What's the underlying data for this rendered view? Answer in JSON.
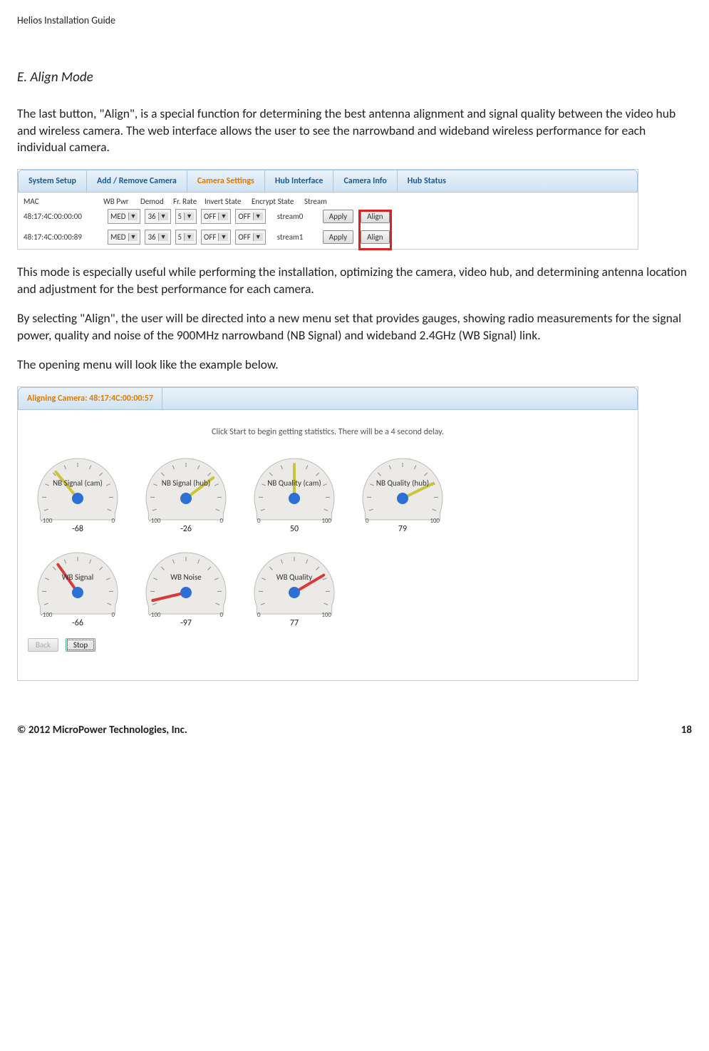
{
  "doc": {
    "header": "Helios Installation Guide",
    "section_title": "E. Align Mode",
    "para1": "The last button, \"Align\", is a special function for determining the best antenna alignment and signal quality between the video hub and  wireless camera.  The web interface allows the user to see the narrowband and wideband wireless performance for each individual camera.",
    "para2": "This mode is especially useful while performing the installation, optimizing the camera, video hub, and determining antenna location and adjustment for the best performance for each camera.",
    "para3": "By selecting \"Align\", the user will be directed into a new menu set that provides gauges, showing radio measurements for the signal power, quality and noise of the 900MHz narrowband (NB Signal) and wideband 2.4GHz (WB Signal) link.",
    "para4": "The opening menu will look like the example below.",
    "footer_left": "© 2012 MicroPower Technologies, Inc.",
    "footer_right": "18"
  },
  "shot1": {
    "tabs": [
      "System Setup",
      "Add / Remove Camera",
      "Camera Settings",
      "Hub Interface",
      "Camera Info",
      "Hub Status"
    ],
    "cols": {
      "mac": "MAC",
      "wbpwr": "WB Pwr",
      "demod": "Demod",
      "fr": "Fr. Rate",
      "invert": "Invert State",
      "encrypt": "Encrypt State",
      "stream": "Stream"
    },
    "rows": [
      {
        "mac": "48:17:4C:00:00:00",
        "wbpwr": "MED",
        "demod": "36",
        "fr": "5",
        "invert": "OFF",
        "encrypt": "OFF",
        "stream": "stream0"
      },
      {
        "mac": "48:17:4C:00:00:89",
        "wbpwr": "MED",
        "demod": "36",
        "fr": "5",
        "invert": "OFF",
        "encrypt": "OFF",
        "stream": "stream1"
      }
    ],
    "apply_label": "Apply",
    "align_label": "Align"
  },
  "shot2": {
    "title": "Aligning Camera: 48:17:4C:00:00:57",
    "hint": "Click Start to begin getting statistics. There will be a 4 second delay.",
    "back": "Back",
    "stop": "Stop"
  },
  "chart_data": [
    {
      "type": "gauge",
      "title": "NB Signal (cam)",
      "min": -100,
      "max": 0,
      "value": -68,
      "needle_color": "#c9c43a"
    },
    {
      "type": "gauge",
      "title": "NB Signal (hub)",
      "min": -100,
      "max": 0,
      "value": -26,
      "needle_color": "#c9c43a"
    },
    {
      "type": "gauge",
      "title": "NB Quality (cam)",
      "min": 0,
      "max": 100,
      "value": 50,
      "needle_color": "#c9c43a"
    },
    {
      "type": "gauge",
      "title": "NB Quality (hub)",
      "min": 0,
      "max": 100,
      "value": 79,
      "needle_color": "#c9c43a"
    },
    {
      "type": "gauge",
      "title": "WB Signal",
      "min": -100,
      "max": 0,
      "value": -66,
      "needle_color": "#d63a3a"
    },
    {
      "type": "gauge",
      "title": "WB Noise",
      "min": -100,
      "max": 0,
      "value": -97,
      "needle_color": "#d63a3a"
    },
    {
      "type": "gauge",
      "title": "WB Quality",
      "min": 0,
      "max": 100,
      "value": 77,
      "needle_color": "#d63a3a"
    }
  ]
}
